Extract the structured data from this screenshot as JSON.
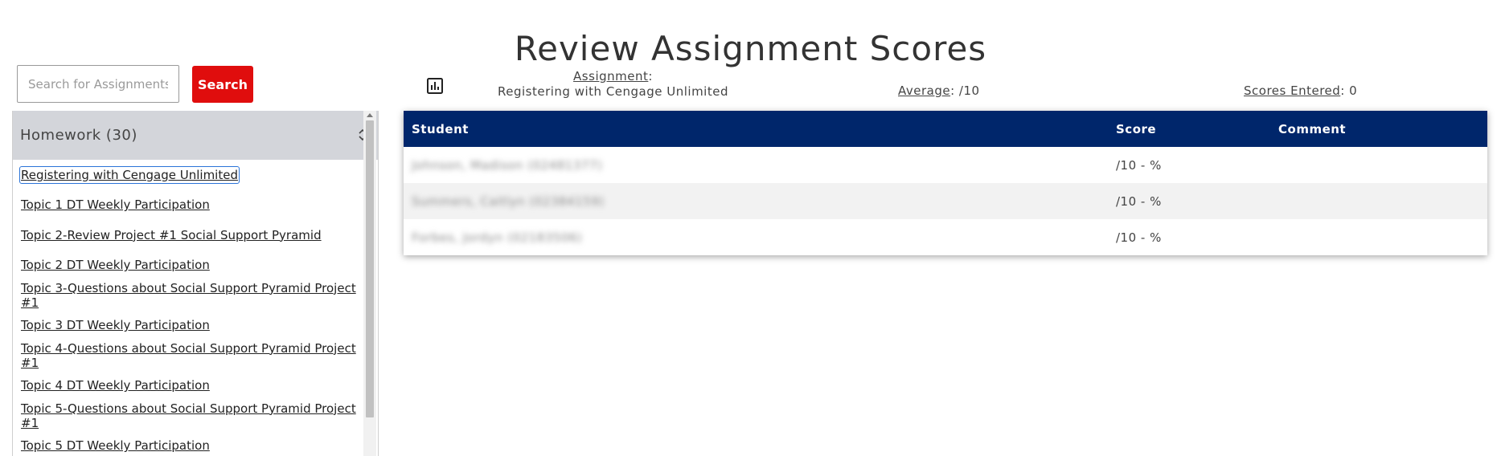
{
  "page": {
    "title": "Review Assignment Scores"
  },
  "search": {
    "placeholder": "Search for Assignments",
    "value": "",
    "button_label": "Search"
  },
  "sidebar": {
    "group": {
      "label": "Homework (30)",
      "toggle_icon": "chevron-up-down-icon"
    },
    "items": [
      {
        "label": "Registering with Cengage Unlimited",
        "selected": true
      },
      {
        "label": "Topic 1 DT Weekly Participation"
      },
      {
        "label": "Topic 2-Review Project #1 Social Support Pyramid"
      },
      {
        "label": "Topic 2 DT Weekly Participation"
      },
      {
        "label": "Topic 3-Questions about Social Support Pyramid Project #1"
      },
      {
        "label": "Topic 3 DT Weekly Participation"
      },
      {
        "label": "Topic 4-Questions about Social Support Pyramid Project #1"
      },
      {
        "label": "Topic 4 DT Weekly Participation"
      },
      {
        "label": "Topic 5-Questions about Social Support Pyramid Project #1"
      },
      {
        "label": "Topic 5 DT Weekly Participation"
      }
    ]
  },
  "summary": {
    "chart_icon": "bar-chart-icon",
    "assignment_label": "Assignment",
    "assignment_name": "Registering with Cengage Unlimited",
    "average_label": "Average",
    "average_value": ": /10",
    "scores_entered_label": "Scores Entered",
    "scores_entered_value": ": 0"
  },
  "table": {
    "columns": [
      "Student",
      "Score",
      "Comment"
    ],
    "rows": [
      {
        "student": "Johnson, Madison (02481377)",
        "score": "/10 - %",
        "comment": ""
      },
      {
        "student": "Summers, Caitlyn (02384159)",
        "score": "/10 - %",
        "comment": ""
      },
      {
        "student": "Forbes, Jordyn (02183506)",
        "score": "/10 - %",
        "comment": ""
      }
    ]
  },
  "colors": {
    "accent_red": "#e00d0d",
    "table_header": "#00266b",
    "group_header_bg": "#d3d5da",
    "selected_outline": "#2b74d8"
  }
}
